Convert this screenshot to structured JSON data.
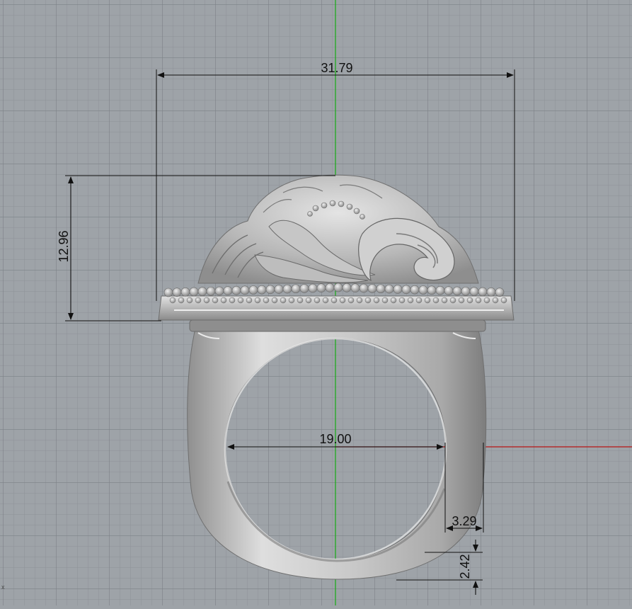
{
  "viewport": {
    "name": "front-viewport",
    "background": "#9ea3a8",
    "grid_minor_color": "#8c9196",
    "grid_major_color": "#7b8085",
    "y_axis_color": "#1faa1f",
    "x_axis_color": "#b81414",
    "axis_indicator": "x"
  },
  "model": {
    "name": "ring",
    "color": "#c3c3c3"
  },
  "dimensions": {
    "top_width": "31.79",
    "head_height": "12.96",
    "inner_diameter": "19.00",
    "shank_width": "3.29",
    "shank_thickness": "2.42"
  }
}
